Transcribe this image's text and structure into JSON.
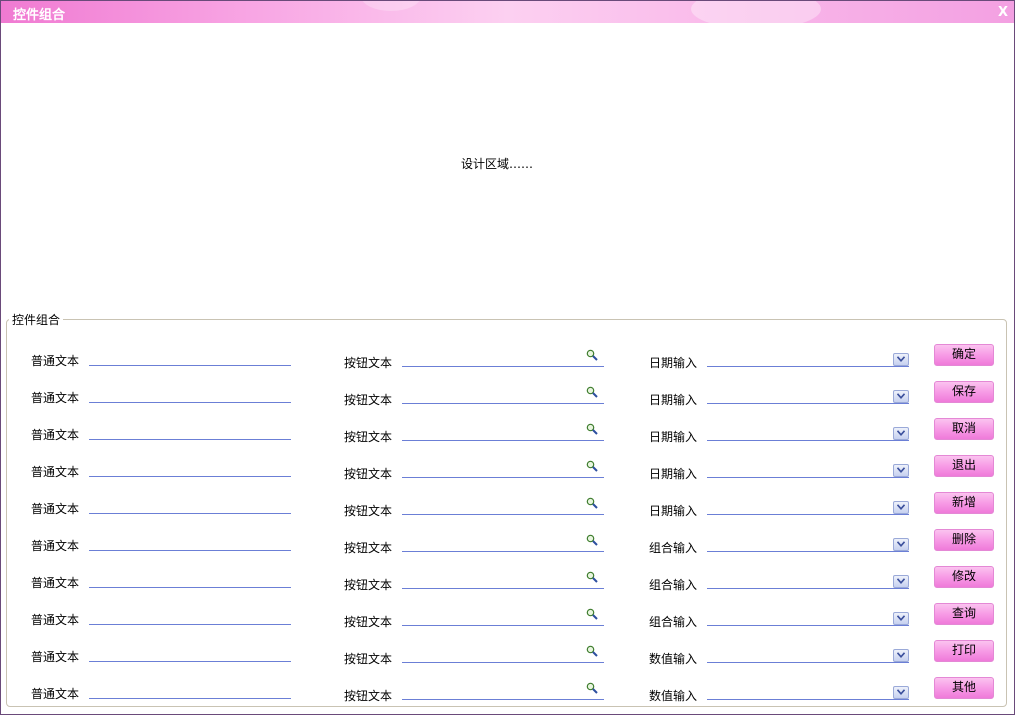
{
  "window": {
    "title": "控件组合",
    "close_label": "X"
  },
  "design_area": {
    "text": "设计区域……"
  },
  "group": {
    "legend": "控件组合"
  },
  "rows": [
    {
      "text_label": "普通文本",
      "button_label": "按钮文本",
      "input_label": "日期输入",
      "action": "确定"
    },
    {
      "text_label": "普通文本",
      "button_label": "按钮文本",
      "input_label": "日期输入",
      "action": "保存"
    },
    {
      "text_label": "普通文本",
      "button_label": "按钮文本",
      "input_label": "日期输入",
      "action": "取消"
    },
    {
      "text_label": "普通文本",
      "button_label": "按钮文本",
      "input_label": "日期输入",
      "action": "退出"
    },
    {
      "text_label": "普通文本",
      "button_label": "按钮文本",
      "input_label": "日期输入",
      "action": "新增"
    },
    {
      "text_label": "普通文本",
      "button_label": "按钮文本",
      "input_label": "组合输入",
      "action": "删除"
    },
    {
      "text_label": "普通文本",
      "button_label": "按钮文本",
      "input_label": "组合输入",
      "action": "修改"
    },
    {
      "text_label": "普通文本",
      "button_label": "按钮文本",
      "input_label": "组合输入",
      "action": "查询"
    },
    {
      "text_label": "普通文本",
      "button_label": "按钮文本",
      "input_label": "数值输入",
      "action": "打印"
    },
    {
      "text_label": "普通文本",
      "button_label": "按钮文本",
      "input_label": "数值输入",
      "action": "其他"
    }
  ],
  "colors": {
    "accent": "#f79be6",
    "field_underline": "#6b7fd6"
  },
  "icons": {
    "lookup": "search-icon",
    "dropdown": "chevron-down-icon"
  }
}
